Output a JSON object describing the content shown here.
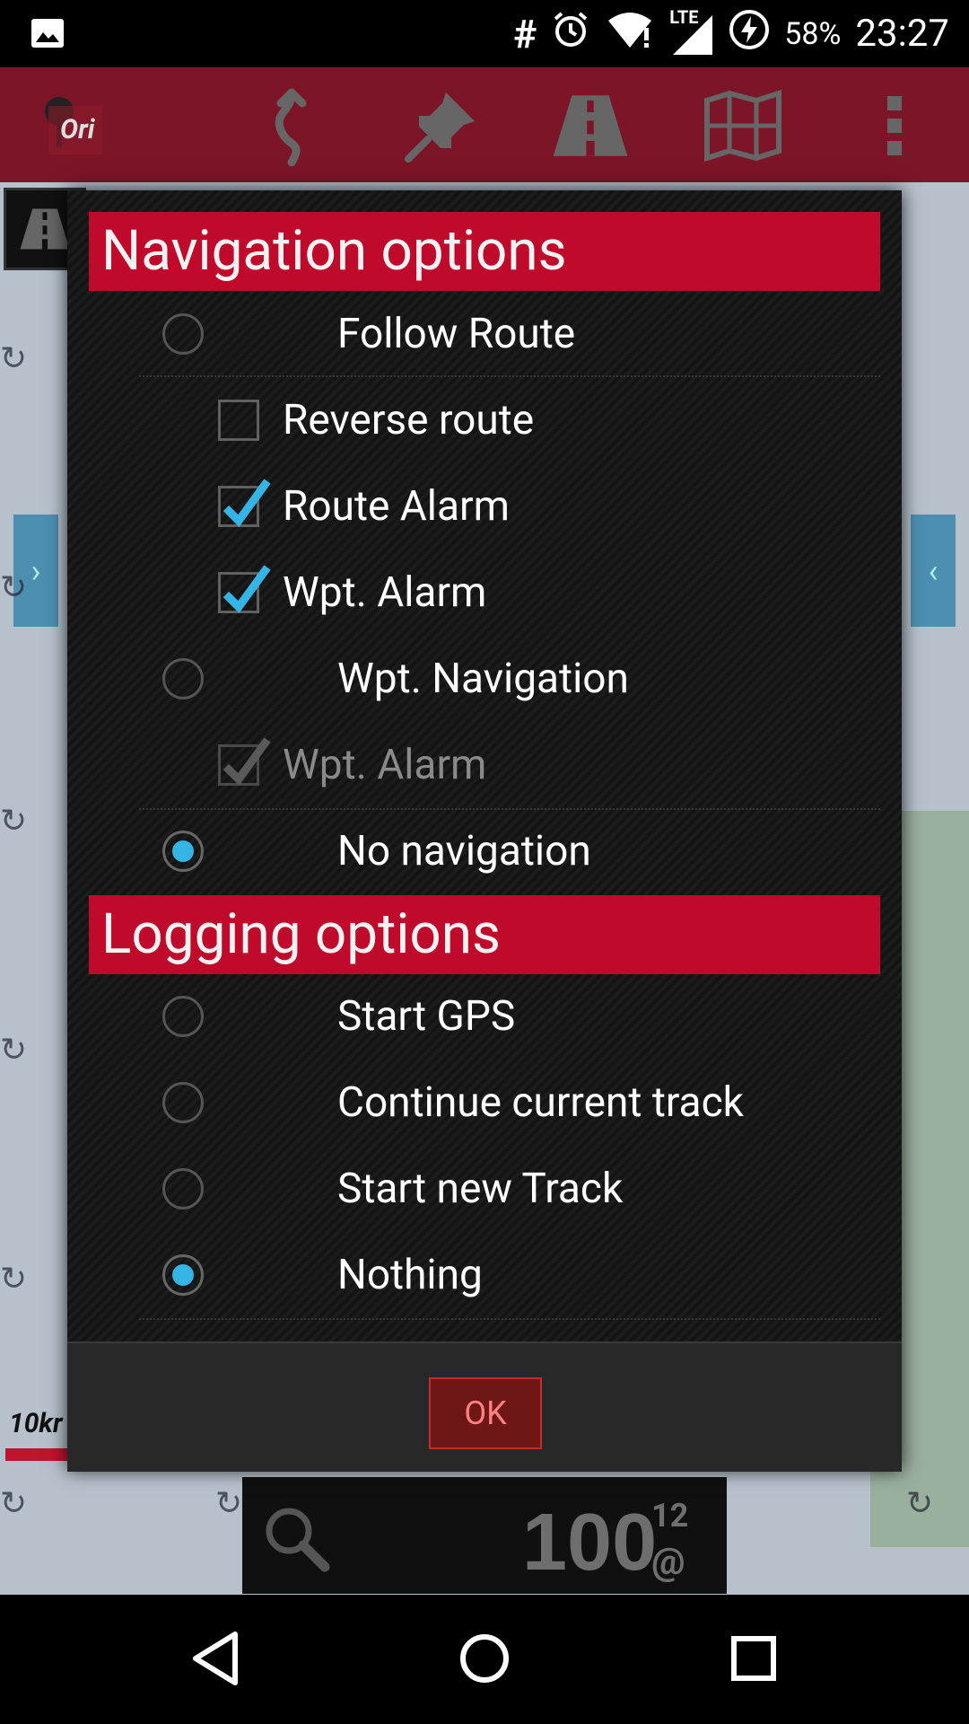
{
  "status_bar": {
    "hash": "#",
    "network": "LTE",
    "battery_percent": "58%",
    "time": "23:27"
  },
  "toolbar": {
    "logo_text": "Ori",
    "icons": [
      "route-icon",
      "waypoint-pin-icon",
      "road-icon",
      "map-icon",
      "overflow-menu-icon"
    ]
  },
  "map": {
    "scale_label": "10kr",
    "left_tab_arrow": "›",
    "right_tab_arrow": "‹"
  },
  "bottom_panel": {
    "speed": "100",
    "superscript": "12",
    "at": "@"
  },
  "dialog": {
    "navigation_header": "Navigation options",
    "navigation_items": [
      {
        "type": "radio",
        "label": "Follow Route",
        "checked": false
      },
      {
        "type": "check",
        "label": "Reverse route",
        "checked": false,
        "enabled": true
      },
      {
        "type": "check",
        "label": "Route Alarm",
        "checked": true,
        "enabled": true
      },
      {
        "type": "check",
        "label": "Wpt. Alarm",
        "checked": true,
        "enabled": true
      },
      {
        "type": "radio",
        "label": "Wpt. Navigation",
        "checked": false
      },
      {
        "type": "check",
        "label": "Wpt. Alarm",
        "checked": true,
        "enabled": false
      },
      {
        "type": "radio",
        "label": "No navigation",
        "checked": true
      }
    ],
    "logging_header": "Logging options",
    "logging_items": [
      {
        "type": "radio",
        "label": "Start GPS",
        "checked": false
      },
      {
        "type": "radio",
        "label": "Continue current track",
        "checked": false
      },
      {
        "type": "radio",
        "label": "Start new Track",
        "checked": false
      },
      {
        "type": "radio",
        "label": "Nothing",
        "checked": true
      }
    ],
    "ok_label": "OK"
  },
  "colors": {
    "accent_red": "#bf0a2b",
    "toolbar_red": "#7d1528",
    "radio_blue": "#34b5e5"
  }
}
